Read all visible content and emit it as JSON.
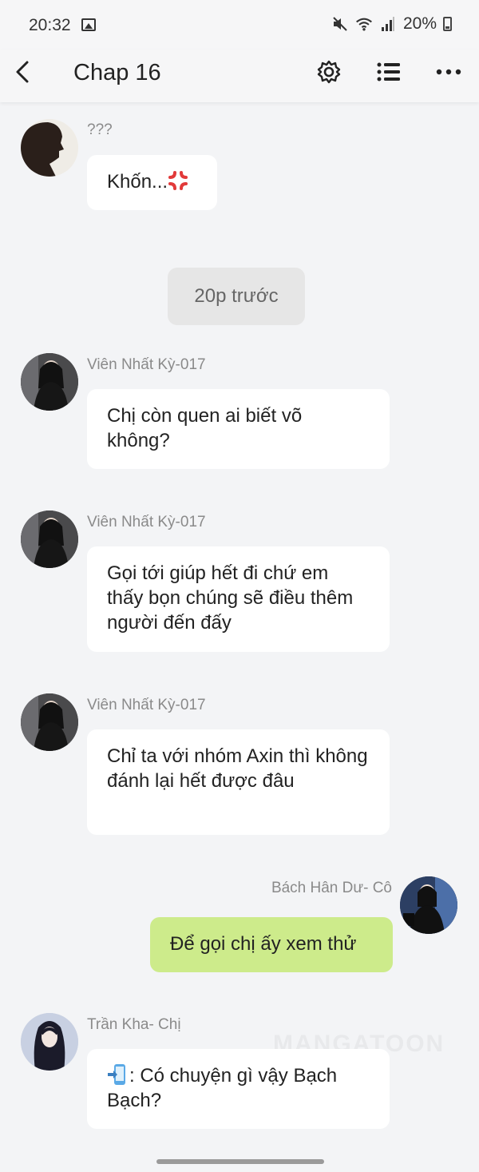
{
  "status_bar": {
    "time": "20:32",
    "battery": "20%",
    "icons": [
      "image-icon",
      "mute-icon",
      "wifi-icon",
      "signal-icon",
      "battery-icon"
    ]
  },
  "header": {
    "title": "Chap 16",
    "icons": [
      "back-icon",
      "settings-icon",
      "list-icon",
      "more-icon"
    ]
  },
  "messages": [
    {
      "name": "???",
      "text": "Khốn...",
      "emoji": "anger-icon",
      "side": "left"
    },
    {
      "name": "Viên Nhất Kỳ-017",
      "text": "Chị còn quen ai biết võ không?",
      "side": "left"
    },
    {
      "name": "Viên Nhất Kỳ-017",
      "text": "Gọi tới giúp hết đi chứ em thấy bọn chúng sẽ điều thêm người đến đấy",
      "side": "left"
    },
    {
      "name": "Viên Nhất Kỳ-017",
      "text": "Chỉ ta với nhóm Axin thì không đánh lại hết được đâu",
      "side": "left"
    },
    {
      "name": "Bách Hân Dư- Cô",
      "text": "Để gọi chị ấy xem thử",
      "side": "right"
    },
    {
      "name": "Trần Kha- Chị",
      "text": ": Có chuyện gì vậy Bạch Bạch?",
      "emoji": "phone-icon",
      "side": "left"
    }
  ],
  "time_divider": "20p trước",
  "watermark": "MANGATOON",
  "colors": {
    "background": "#f3f4f6",
    "bubble": "#ffffff",
    "own_bubble": "#cdeb8b",
    "name": "#8a8a8a"
  }
}
